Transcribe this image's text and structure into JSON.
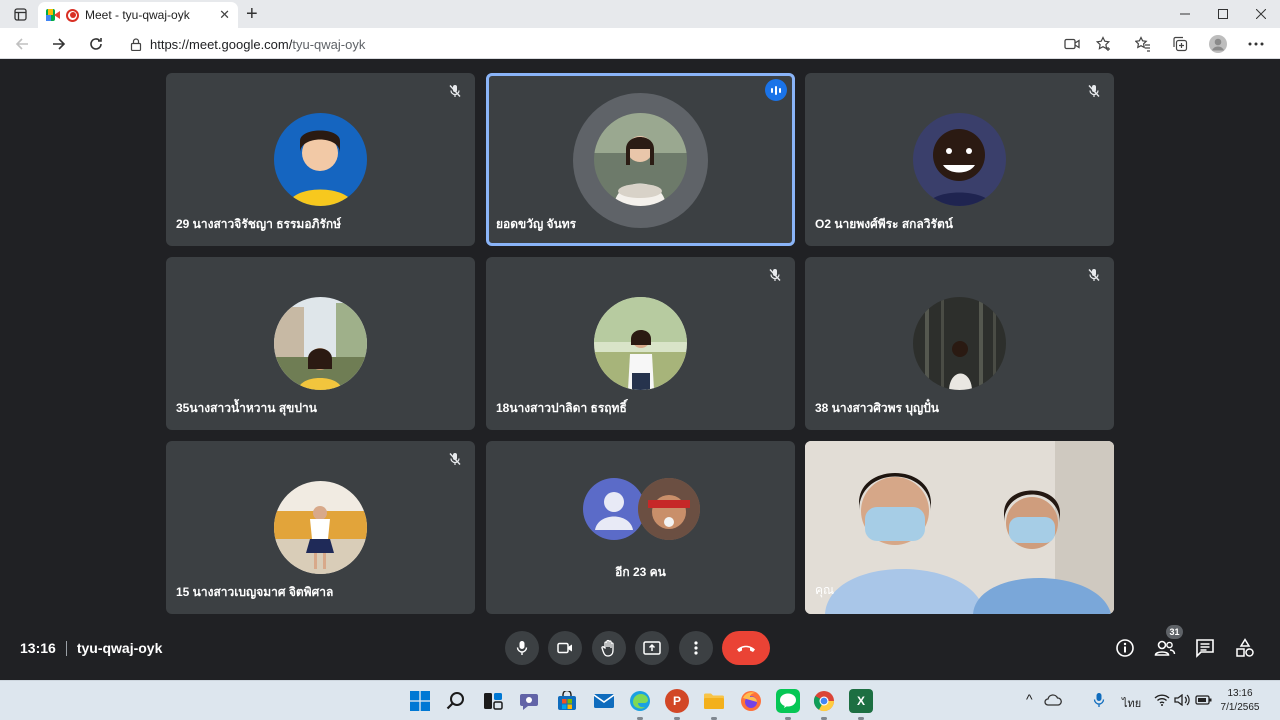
{
  "browser": {
    "tab_title": "Meet - tyu-qwaj-oyk",
    "tab_close": "✕",
    "new_tab": "+",
    "url_host": "https://meet.google.com/",
    "url_path": "tyu-qwaj-oyk"
  },
  "participants": [
    {
      "name": "29 นางสาวจิรัชญา ธรรมอภิรักษ์",
      "muted": true
    },
    {
      "name": "ยอดขวัญ จันทร",
      "speaking": true
    },
    {
      "name": "O2 นายพงศ์พีระ สกลวิรัตน์",
      "muted": true
    },
    {
      "name": "35นางสาวน้ำหวาน สุขปาน",
      "muted": false
    },
    {
      "name": "18นางสาวปาลิดา ธรฤทธิ์",
      "muted": true
    },
    {
      "name": "38 นางสาวศิวพร บุญปั๋น",
      "muted": true
    },
    {
      "name": "15 นางสาวเบญจมาศ จิตพิศาล",
      "muted": true
    }
  ],
  "others": {
    "label": "อีก 23 คน"
  },
  "self_view": {
    "label": "คุณ"
  },
  "meeting": {
    "time": "13:16",
    "code": "tyu-qwaj-oyk",
    "people_count": "31"
  },
  "taskbar": {
    "tray_language": "ไทย",
    "clock_time": "13:16",
    "clock_date": "7/1/2565",
    "tray_chevron": "^"
  },
  "colors": {
    "meet_bg": "#202124",
    "tile_bg": "#3c4043",
    "end_call": "#ea4335",
    "speaking": "#8ab4f8"
  }
}
